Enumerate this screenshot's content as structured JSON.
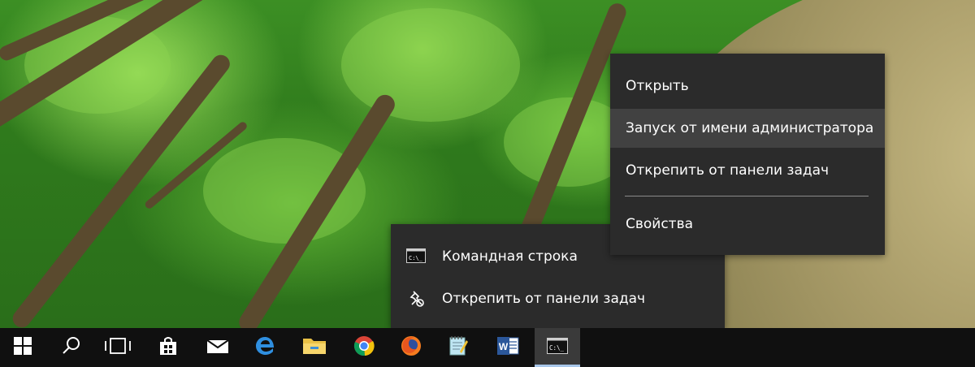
{
  "context_menu": {
    "items": [
      {
        "label": "Открыть",
        "icon": null
      },
      {
        "label": "Запуск от имени администратора",
        "icon": null,
        "highlighted": true
      },
      {
        "label": "Открепить от панели задач",
        "icon": null
      },
      {
        "label": "Свойства",
        "icon": null
      }
    ]
  },
  "jump_list": {
    "items": [
      {
        "label": "Командная строка",
        "icon": "cmd-icon"
      },
      {
        "label": "Открепить от панели задач",
        "icon": "unpin-icon"
      }
    ]
  },
  "taskbar": {
    "buttons": [
      {
        "name": "start-button",
        "icon": "windows-logo-icon"
      },
      {
        "name": "search-button",
        "icon": "search-icon"
      },
      {
        "name": "task-view-button",
        "icon": "task-view-icon"
      },
      {
        "name": "store-button",
        "icon": "store-bag-icon"
      },
      {
        "name": "mail-button",
        "icon": "mail-icon"
      },
      {
        "name": "edge-button",
        "icon": "edge-icon"
      },
      {
        "name": "file-explorer-button",
        "icon": "folder-icon"
      },
      {
        "name": "chrome-button",
        "icon": "chrome-icon"
      },
      {
        "name": "firefox-button",
        "icon": "firefox-icon"
      },
      {
        "name": "notepad-button",
        "icon": "notepad-icon"
      },
      {
        "name": "word-button",
        "icon": "word-icon"
      },
      {
        "name": "cmd-button",
        "icon": "cmd-icon",
        "active": true
      }
    ]
  },
  "colors": {
    "menu_bg": "#2b2b2b",
    "menu_hover": "#414141",
    "taskbar_bg": "#101010",
    "active_indicator": "#a8c7ea"
  }
}
